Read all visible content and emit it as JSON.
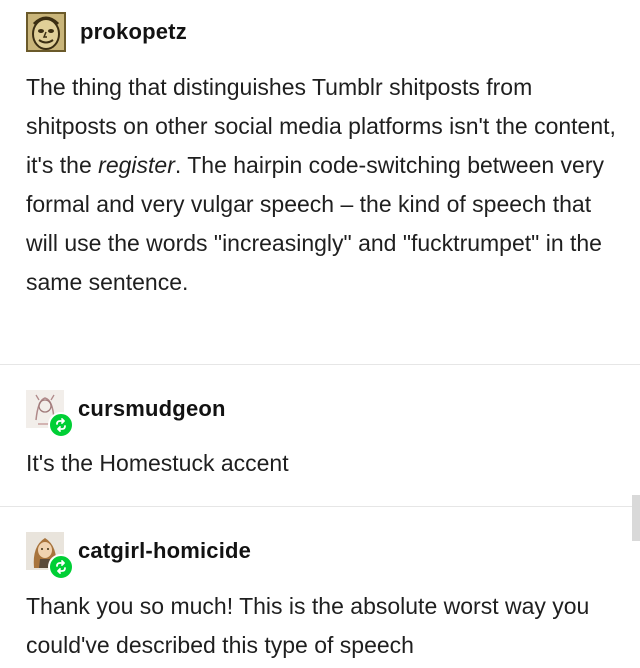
{
  "posts": [
    {
      "username": "prokopetz",
      "avatar_icon": "sketched-face-avatar-icon",
      "reblogged": false,
      "body_before": "The thing that distinguishes Tumblr shitposts from shitposts on other social media platforms isn't the content, it's the ",
      "body_em": "register",
      "body_after": ". The hairpin code-switching between very formal and very vulgar speech – the kind of speech that will use the words \"increasingly\" and \"fucktrumpet\" in the same sentence."
    },
    {
      "username": "cursmudgeon",
      "avatar_icon": "sketch-character-avatar-icon",
      "reblogged": true,
      "body": "It's the Homestuck accent"
    },
    {
      "username": "catgirl-homicide",
      "avatar_icon": "long-hair-character-avatar-icon",
      "reblogged": true,
      "body": "Thank you so much! This is the absolute worst way you could've described this type of speech"
    }
  ],
  "colors": {
    "reblog_badge": "#00cf35",
    "divider": "#e6e6e6",
    "text": "#1f1f1f"
  }
}
